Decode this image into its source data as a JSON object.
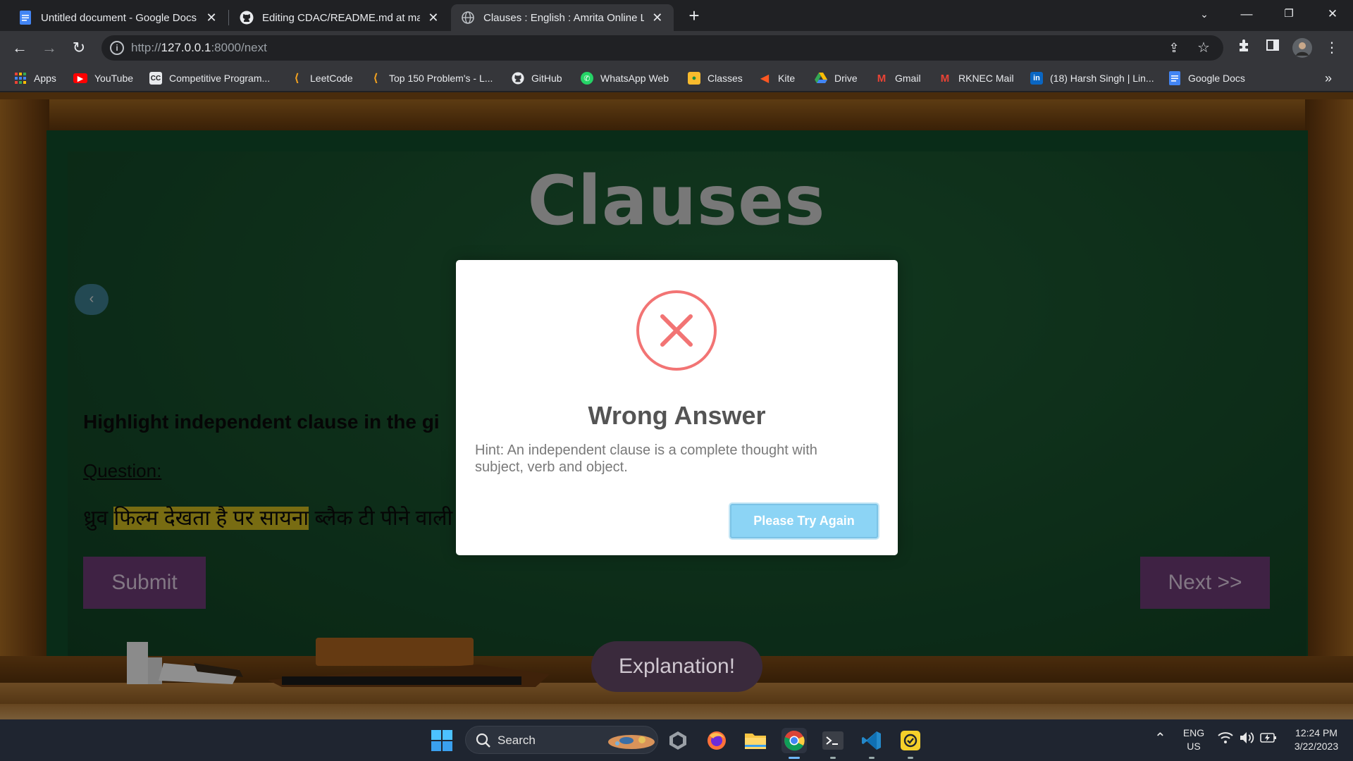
{
  "browser": {
    "tabs": [
      {
        "label": "Untitled document - Google Docs",
        "icon": "google-docs-icon",
        "active": false
      },
      {
        "label": "Editing CDAC/README.md at maste",
        "icon": "github-icon",
        "active": false
      },
      {
        "label": "Clauses : English : Amrita Online Lab",
        "icon": "globe-icon",
        "active": true
      }
    ],
    "new_tab": "+",
    "url_scheme": "http://",
    "url_host": "127.0.0.1",
    "url_rest": ":8000/next",
    "bookmarks": [
      {
        "label": "Apps",
        "icon": "apps-grid-icon"
      },
      {
        "label": "YouTube",
        "icon": "youtube-icon"
      },
      {
        "label": "Competitive Program...",
        "icon": "cc-icon"
      },
      {
        "label": "LeetCode",
        "icon": "leetcode-icon"
      },
      {
        "label": "Top 150 Problem's - L...",
        "icon": "leetcode-icon"
      },
      {
        "label": "GitHub",
        "icon": "github-icon"
      },
      {
        "label": "WhatsApp Web",
        "icon": "whatsapp-icon"
      },
      {
        "label": "Classes",
        "icon": "classroom-icon"
      },
      {
        "label": "Kite",
        "icon": "kite-icon"
      },
      {
        "label": "Drive",
        "icon": "drive-icon"
      },
      {
        "label": "Gmail",
        "icon": "gmail-icon"
      },
      {
        "label": "RKNEC Mail",
        "icon": "gmail-icon"
      },
      {
        "label": "(18) Harsh Singh | Lin...",
        "icon": "linkedin-icon"
      },
      {
        "label": "Google Docs",
        "icon": "google-docs-icon"
      }
    ],
    "bookmarks_overflow": "»"
  },
  "page": {
    "title": "Clauses",
    "prev_symbol": "‹",
    "instruction": "Highlight independent clause in the gi",
    "question_label": "Question:",
    "sentence_before": "ध्रुव ",
    "sentence_highlight": "फिल्म देखता है पर सायना",
    "sentence_after": " ब्लैक टी पीने वाली थी",
    "submit_label": "Submit",
    "next_label": "Next >>",
    "explanation_label": "Explanation!"
  },
  "modal": {
    "title": "Wrong Answer",
    "hint": "Hint: An independent clause is a complete thought with subject, verb and object.",
    "button_label": "Please Try Again",
    "icon": "error-x-icon",
    "accent": "#f27474",
    "button_color": "#8cd4f5"
  },
  "taskbar": {
    "search_label": "Search",
    "language": "ENG",
    "region": "US",
    "time": "12:24 PM",
    "date": "3/22/2023"
  }
}
